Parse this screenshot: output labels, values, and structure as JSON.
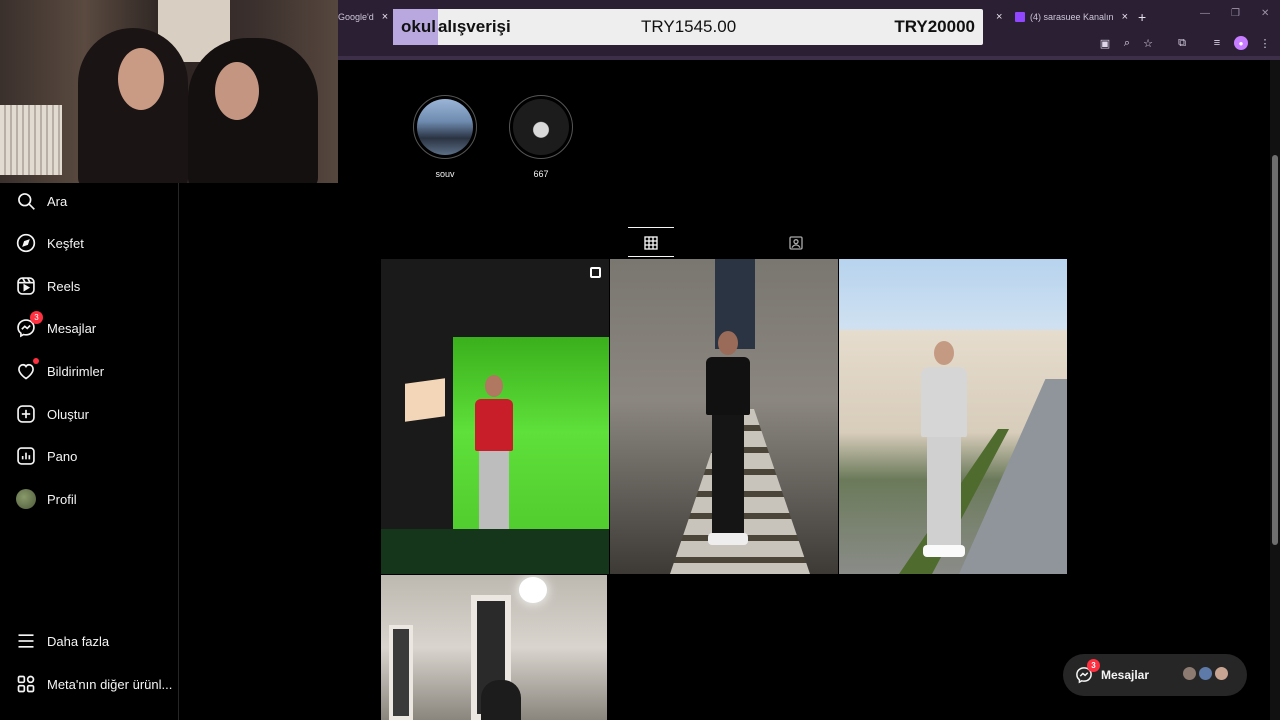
{
  "browser": {
    "tabs": [
      {
        "title": "Google'd"
      },
      {
        "title": "(4) sarasuee Kanalın"
      }
    ]
  },
  "donation": {
    "highlight": "okul",
    "title": "alışverişi",
    "raised": "TRY1545.00",
    "goal": "TRY20000"
  },
  "sidebar": {
    "items": [
      {
        "label": "Ara",
        "icon": "search-icon"
      },
      {
        "label": "Keşfet",
        "icon": "compass-icon"
      },
      {
        "label": "Reels",
        "icon": "reels-icon"
      },
      {
        "label": "Mesajlar",
        "icon": "messenger-icon",
        "badge": "3"
      },
      {
        "label": "Bildirimler",
        "icon": "heart-icon"
      },
      {
        "label": "Oluştur",
        "icon": "plus-square-icon"
      },
      {
        "label": "Pano",
        "icon": "dashboard-icon"
      },
      {
        "label": "Profil",
        "icon": "avatar"
      }
    ],
    "more": "Daha fazla",
    "meta": "Meta'nın diğer ürünl..."
  },
  "highlights": [
    {
      "label": "souv"
    },
    {
      "label": "667"
    }
  ],
  "tabs": {
    "active": "posts"
  },
  "messages": {
    "label": "Mesajlar",
    "badge": "3"
  },
  "colors": {
    "accent": "#ff3040",
    "sidebar_bg": "#000000",
    "chrome_bg": "#2a1f33",
    "donation_highlight": "#b9a8e0"
  }
}
